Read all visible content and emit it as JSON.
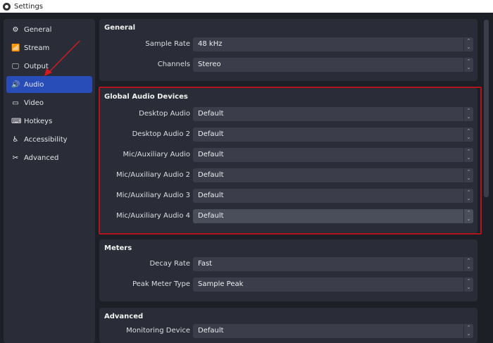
{
  "window": {
    "title": "Settings"
  },
  "sidebar": {
    "items": [
      {
        "label": "General",
        "icon": "gear-icon",
        "glyph": "⚙"
      },
      {
        "label": "Stream",
        "icon": "antenna-icon",
        "glyph": "📶"
      },
      {
        "label": "Output",
        "icon": "output-icon",
        "glyph": "🖵"
      },
      {
        "label": "Audio",
        "icon": "speaker-icon",
        "glyph": "🔊",
        "active": true
      },
      {
        "label": "Video",
        "icon": "monitor-icon",
        "glyph": "▭"
      },
      {
        "label": "Hotkeys",
        "icon": "keyboard-icon",
        "glyph": "⌨"
      },
      {
        "label": "Accessibility",
        "icon": "accessibility-icon",
        "glyph": "♿"
      },
      {
        "label": "Advanced",
        "icon": "tools-icon",
        "glyph": "✂"
      }
    ]
  },
  "sections": [
    {
      "title": "General",
      "rows": [
        {
          "label": "Sample Rate",
          "value": "48 kHz"
        },
        {
          "label": "Channels",
          "value": "Stereo"
        }
      ]
    },
    {
      "title": "Global Audio Devices",
      "rows": [
        {
          "label": "Desktop Audio",
          "value": "Default"
        },
        {
          "label": "Desktop Audio 2",
          "value": "Default"
        },
        {
          "label": "Mic/Auxiliary Audio",
          "value": "Default"
        },
        {
          "label": "Mic/Auxiliary Audio 2",
          "value": "Default"
        },
        {
          "label": "Mic/Auxiliary Audio 3",
          "value": "Default"
        },
        {
          "label": "Mic/Auxiliary Audio 4",
          "value": "Default"
        }
      ]
    },
    {
      "title": "Meters",
      "rows": [
        {
          "label": "Decay Rate",
          "value": "Fast"
        },
        {
          "label": "Peak Meter Type",
          "value": "Sample Peak"
        }
      ]
    },
    {
      "title": "Advanced",
      "rows": [
        {
          "label": "Monitoring Device",
          "value": "Default"
        }
      ]
    }
  ],
  "colors": {
    "accent": "#284cb8",
    "highlight_box": "#b0141c",
    "annotation_arrow": "#d11a22"
  }
}
